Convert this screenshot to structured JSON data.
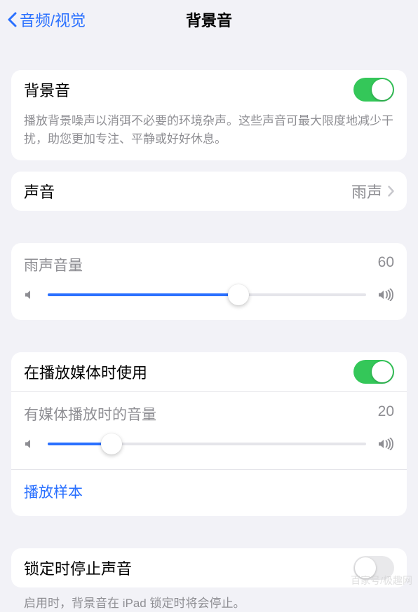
{
  "header": {
    "back_label": "音频/视觉",
    "title": "背景音"
  },
  "group1": {
    "main_label": "背景音",
    "main_on": true,
    "description": "播放背景噪声以消弭不必要的环境杂声。这些声音可最大限度地减少干扰，助您更加专注、平静或好好休息。"
  },
  "group2": {
    "label": "声音",
    "value": "雨声"
  },
  "group3": {
    "label": "雨声音量",
    "value": "60",
    "percent": 60
  },
  "group4": {
    "row_label": "在播放媒体时使用",
    "row_on": true,
    "slider_label": "有媒体播放时的音量",
    "slider_value": "20",
    "slider_percent": 20,
    "sample_link": "播放样本"
  },
  "group5": {
    "label": "锁定时停止声音",
    "on": false,
    "footer": "启用时，背景音在 iPad 锁定时将会停止。"
  },
  "watermark": "百家号/极趣网"
}
